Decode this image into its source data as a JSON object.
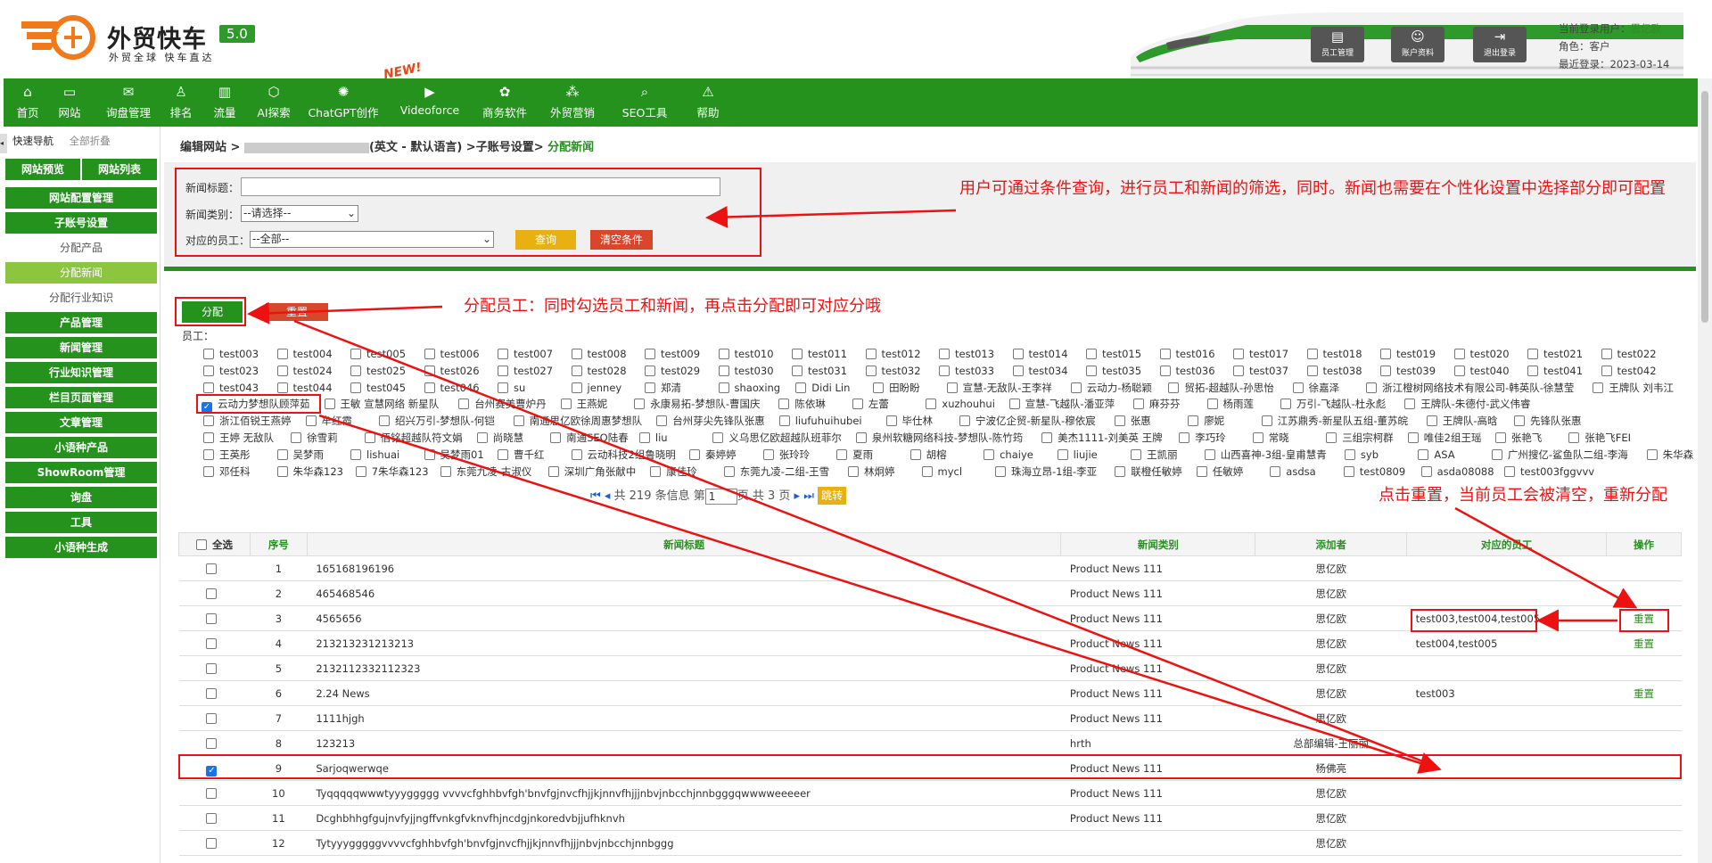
{
  "header": {
    "brand": "外贸快车",
    "version": "5.0",
    "slogan": "外贸全球 快车直达",
    "buttons": [
      {
        "label": "员工管理",
        "icon": "staff-icon"
      },
      {
        "label": "账户资料",
        "icon": "account-icon"
      },
      {
        "label": "退出登录",
        "icon": "logout-icon"
      }
    ],
    "user_label": "当前登录用户：",
    "user_value": "思亿欧",
    "role_label": "角色：",
    "role_value": "客户",
    "last_login_label": "最近登录：",
    "last_login_value": "2023-03-14"
  },
  "nav": {
    "new_tag": "NEW!",
    "items": [
      {
        "label": "首页",
        "icon": "home-icon"
      },
      {
        "label": "网站",
        "icon": "website-icon"
      },
      {
        "label": "询盘管理",
        "icon": "mail-icon"
      },
      {
        "label": "排名",
        "icon": "ranking-icon"
      },
      {
        "label": "流量",
        "icon": "traffic-icon"
      },
      {
        "label": "AI探索",
        "icon": "ai-icon"
      },
      {
        "label": "ChatGPT创作",
        "icon": "chatgpt-icon"
      },
      {
        "label": "Videoforce",
        "icon": "video-icon"
      },
      {
        "label": "商务软件",
        "icon": "software-icon"
      },
      {
        "label": "外贸营销",
        "icon": "marketing-icon"
      },
      {
        "label": "SEO工具",
        "icon": "search-icon"
      },
      {
        "label": "帮助",
        "icon": "help-icon"
      }
    ]
  },
  "sidebar": {
    "tab_quick": "快速导航",
    "tab_collapse": "全部折叠",
    "toggle": "◂",
    "top_left": "网站预览",
    "top_right": "网站列表",
    "items": [
      {
        "label": "网站配置管理",
        "type": "group"
      },
      {
        "label": "子账号设置",
        "type": "group"
      },
      {
        "label": "分配产品",
        "type": "sub"
      },
      {
        "label": "分配新闻",
        "type": "active"
      },
      {
        "label": "分配行业知识",
        "type": "sub"
      },
      {
        "label": "产品管理",
        "type": "group"
      },
      {
        "label": "新闻管理",
        "type": "group"
      },
      {
        "label": "行业知识管理",
        "type": "group"
      },
      {
        "label": "栏目页面管理",
        "type": "group"
      },
      {
        "label": "文章管理",
        "type": "group"
      },
      {
        "label": "小语种产品",
        "type": "group"
      },
      {
        "label": "ShowRoom管理",
        "type": "group"
      },
      {
        "label": "询盘",
        "type": "group"
      },
      {
        "label": "工具",
        "type": "group"
      },
      {
        "label": "小语种生成",
        "type": "group"
      }
    ]
  },
  "breadcrumb": {
    "prefix": "编辑网站 >",
    "middle": "(英文 - 默认语言) >子账号设置>",
    "current": "分配新闻"
  },
  "filter": {
    "title_label": "新闻标题：",
    "title_value": "",
    "category_label": "新闻类别：",
    "category_value": "--请选择--",
    "staff_label": "对应的员工：",
    "staff_value": "--全部--",
    "query_button": "查询",
    "clear_button": "清空条件"
  },
  "annotations": {
    "filter_note": "用户可通过条件查询，进行员工和新闻的筛选，同时。新闻也需要在个性化设置中选择部分即可配置",
    "assign_note": "分配员工：同时勾选员工和新闻，再点击分配即可对应分哦",
    "reset_note": "点击重置，当前员工会被清空，重新分配"
  },
  "assign": {
    "assign_button": "分配",
    "reset_button": "重置",
    "staff_label": "员工："
  },
  "staff_rows": [
    [
      [
        "test003",
        0
      ],
      [
        "test004",
        0
      ],
      [
        "test005",
        0
      ],
      [
        "test006",
        0
      ],
      [
        "test007",
        0
      ],
      [
        "test008",
        0
      ],
      [
        "test009",
        0
      ],
      [
        "test010",
        0
      ],
      [
        "test011",
        0
      ],
      [
        "test012",
        0
      ],
      [
        "test013",
        0
      ],
      [
        "test014",
        0
      ],
      [
        "test015",
        0
      ],
      [
        "test016",
        0
      ],
      [
        "test017",
        0
      ],
      [
        "test018",
        0
      ],
      [
        "test019",
        0
      ],
      [
        "test020",
        0
      ],
      [
        "test021",
        0
      ],
      [
        "test022",
        0
      ]
    ],
    [
      [
        "test023",
        0
      ],
      [
        "test024",
        0
      ],
      [
        "test025",
        0
      ],
      [
        "test026",
        0
      ],
      [
        "test027",
        0
      ],
      [
        "test028",
        0
      ],
      [
        "test029",
        0
      ],
      [
        "test030",
        0
      ],
      [
        "test031",
        0
      ],
      [
        "test032",
        0
      ],
      [
        "test033",
        0
      ],
      [
        "test034",
        0
      ],
      [
        "test035",
        0
      ],
      [
        "test036",
        0
      ],
      [
        "test037",
        0
      ],
      [
        "test038",
        0
      ],
      [
        "test039",
        0
      ],
      [
        "test040",
        0
      ],
      [
        "test041",
        0
      ],
      [
        "test042",
        0
      ]
    ],
    [
      [
        "test043",
        0
      ],
      [
        "test044",
        0
      ],
      [
        "test045",
        0
      ],
      [
        "test046",
        0
      ],
      [
        "su",
        0
      ],
      [
        "jenney",
        0
      ],
      [
        "郑清",
        0
      ],
      [
        "shaoxing",
        0
      ],
      [
        "Didi Lin",
        0
      ],
      [
        "田盼盼",
        0
      ],
      [
        "宣慧-无敌队-王李祥",
        0
      ],
      [
        "云动力-杨聪颖",
        0
      ],
      [
        "贸拓-超越队-孙思怡",
        0
      ],
      [
        "徐嘉泽",
        0
      ],
      [
        "浙江橙树网络技术有限公司-韩英队-徐慧莹",
        0
      ],
      [
        "王牌队 刘韦江",
        0
      ]
    ],
    [
      [
        "云动力梦想队顾萍茹",
        1
      ],
      [
        "王敏 宣慧网络 新星队",
        0
      ],
      [
        "台州赛美曹炉丹",
        0
      ],
      [
        "王燕妮",
        0
      ],
      [
        "永康易拓-梦想队-曹国庆",
        0
      ],
      [
        "陈依琳",
        0
      ],
      [
        "左蕾",
        0
      ],
      [
        "xuzhouhui",
        0
      ],
      [
        "宣慧-飞越队-潘亚萍",
        0
      ],
      [
        "麻芬芬",
        0
      ],
      [
        "杨雨莲",
        0
      ],
      [
        "万引-飞越队-杜永彪",
        0
      ],
      [
        "王牌队-朱德付-武义伟睿",
        0
      ]
    ],
    [
      [
        "浙江佰锐王燕婷",
        0
      ],
      [
        "牟红霞",
        0
      ],
      [
        "绍兴万引-梦想队-何铠",
        0
      ],
      [
        "南通思亿欧徐周惠梦想队",
        0
      ],
      [
        "台州芽尖先锋队张惠",
        0
      ],
      [
        "liufuhuihubei",
        0
      ],
      [
        "毕仕林",
        0
      ],
      [
        "宁波亿企贸-新星队-穆依宸",
        0
      ],
      [
        "张惠",
        0
      ],
      [
        "廖妮",
        0
      ],
      [
        "江苏鼎秀-新星队五组-董苏皖",
        0
      ],
      [
        "王牌队-高晗",
        0
      ],
      [
        "先锋队张惠",
        0
      ]
    ],
    [
      [
        "王婷 无敌队",
        0
      ],
      [
        "徐雪莉",
        0
      ],
      [
        "佰铭超越队符文娟",
        0
      ],
      [
        "尚晓慧",
        0
      ],
      [
        "南通SEO陆春",
        0
      ],
      [
        "liu",
        0
      ],
      [
        "义乌思亿欧超越队班菲尔",
        0
      ],
      [
        "泉州软糖网络科技-梦想队-陈竹筠",
        0
      ],
      [
        "美杰1111-刘美英 王牌",
        0
      ],
      [
        "李巧玲",
        0
      ],
      [
        "常晓",
        0
      ],
      [
        "三组宗柯群",
        0
      ],
      [
        "唯佳2组王瑶",
        0
      ],
      [
        "张艳飞",
        0
      ],
      [
        "张艳飞FEI",
        0
      ]
    ],
    [
      [
        "王英彤",
        0
      ],
      [
        "吴梦雨",
        0
      ],
      [
        "lishuai",
        0
      ],
      [
        "吴梦雨01",
        0
      ],
      [
        "曹千红",
        0
      ],
      [
        "云动科技2组鲁晓明",
        0
      ],
      [
        "秦婷婷",
        0
      ],
      [
        "张玲玲",
        0
      ],
      [
        "夏雨",
        0
      ],
      [
        "胡榕",
        0
      ],
      [
        "chaiye",
        0
      ],
      [
        "liujie",
        0
      ],
      [
        "王凯丽",
        0
      ],
      [
        "山西喜神-3组-皇甫慧青",
        0
      ],
      [
        "syb",
        0
      ],
      [
        "ASA",
        0
      ],
      [
        "广州搜亿-鲨鱼队二组-李海",
        0
      ],
      [
        "朱华森",
        0
      ]
    ],
    [
      [
        "邓任科",
        0
      ],
      [
        "朱华森123",
        0
      ],
      [
        "7朱华森123",
        0
      ],
      [
        "东莞九凌-古淑仪",
        0
      ],
      [
        "深圳广角张献中",
        0
      ],
      [
        "康佳玲",
        0
      ],
      [
        "东莞九凌-二组-王雪",
        0
      ],
      [
        "林炯婷",
        0
      ],
      [
        "mycl",
        0
      ],
      [
        "珠海立昂-1组-李亚",
        0
      ],
      [
        "联橙任敏婷",
        0
      ],
      [
        "任敏婷",
        0
      ],
      [
        "asdsa",
        0
      ],
      [
        "test0809",
        0
      ],
      [
        "asda08088",
        0
      ],
      [
        "test003fggvvv",
        0
      ]
    ]
  ],
  "pager": {
    "total_text": "共 219 条信息 第",
    "page_value": "1",
    "page_suffix": "页 共 3 页",
    "go_button": "跳转"
  },
  "table": {
    "headers": [
      "全选",
      "序号",
      "新闻标题",
      "新闻类别",
      "添加者",
      "对应的员工",
      "操作"
    ],
    "rows": [
      {
        "checked": false,
        "no": "1",
        "title": "165168196196",
        "category": "Product News 111",
        "author": "思亿欧",
        "staff": "",
        "action": ""
      },
      {
        "checked": false,
        "no": "2",
        "title": "465468546",
        "category": "Product News 111",
        "author": "思亿欧",
        "staff": "",
        "action": ""
      },
      {
        "checked": false,
        "no": "3",
        "title": "4565656",
        "category": "Product News 111",
        "author": "思亿欧",
        "staff": "test003,test004,test005",
        "action": "重置"
      },
      {
        "checked": false,
        "no": "4",
        "title": "213213231213213",
        "category": "Product News 111",
        "author": "思亿欧",
        "staff": "test004,test005",
        "action": "重置"
      },
      {
        "checked": false,
        "no": "5",
        "title": "2132112332112323",
        "category": "Product News 111",
        "author": "思亿欧",
        "staff": "",
        "action": ""
      },
      {
        "checked": false,
        "no": "6",
        "title": "2.24 News",
        "category": "Product News 111",
        "author": "思亿欧",
        "staff": "test003",
        "action": "重置"
      },
      {
        "checked": false,
        "no": "7",
        "title": "1111hjgh",
        "category": "Product News 111",
        "author": "思亿欧",
        "staff": "",
        "action": ""
      },
      {
        "checked": false,
        "no": "8",
        "title": "123213",
        "category": "hrth",
        "author": "总部编辑-王丽丽",
        "staff": "",
        "action": ""
      },
      {
        "checked": true,
        "no": "9",
        "title": "Sarjoqwerwqe",
        "category": "Product News 111",
        "author": "杨佛亮",
        "staff": "",
        "action": ""
      },
      {
        "checked": false,
        "no": "10",
        "title": "Tyqqqqqwwwtyyyggggg vvvvcfghhbvfgh'bnvfgjnvcfhjjkjnnvfhjjjnbvjnbcchjnnbgggqwwwweeeeer",
        "category": "Product News 111",
        "author": "思亿欧",
        "staff": "",
        "action": ""
      },
      {
        "checked": false,
        "no": "11",
        "title": "Dcghbhhgfgujnvfyjjngffvnkgfvknvfhjncdgjnkoredvbjjufhknvh",
        "category": "Product News 111",
        "author": "思亿欧",
        "staff": "",
        "action": ""
      },
      {
        "checked": false,
        "no": "12",
        "title": "Tytyyygggggvvvvcfghhbvfgh'bnvfgjnvcfhjjkjnnvfhjjjnbvjnbcchjnnbggg",
        "category": "",
        "author": "思亿欧",
        "staff": "",
        "action": ""
      }
    ]
  },
  "colors": {
    "brand_green": "#25921e",
    "light_green": "#8cc63f",
    "annotation_red": "#e11111",
    "query_yellow": "#e8b010",
    "clear_red": "#d9472b"
  }
}
